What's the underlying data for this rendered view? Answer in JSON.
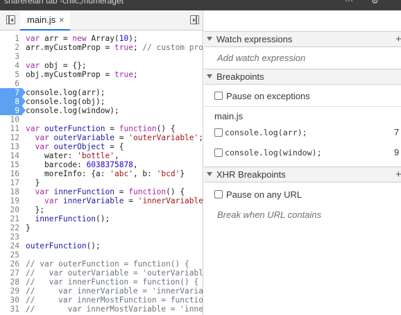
{
  "titlebar": {
    "text": "sharerelan tab -chilc,/numeraget"
  },
  "editor": {
    "tab_label": "main.js",
    "close_glyph": "×",
    "breakpoint_lines": [
      7,
      8,
      9
    ],
    "lines": [
      {
        "n": "1",
        "html": "<span class='kw'>var</span> arr = <span class='kw'>new</span> Array(<span class='num'>10</span>);"
      },
      {
        "n": "2",
        "html": "arr.myCustomProp = <span class='kw'>true</span>; <span class='cm'>// custom prop</span>"
      },
      {
        "n": "3",
        "html": ""
      },
      {
        "n": "4",
        "html": "<span class='kw'>var</span> obj = {};"
      },
      {
        "n": "5",
        "html": "obj.myCustomProp = <span class='kw'>true</span>;"
      },
      {
        "n": "6",
        "html": ""
      },
      {
        "n": "7",
        "html": "console.log(arr);"
      },
      {
        "n": "8",
        "html": "console.log(obj);"
      },
      {
        "n": "9",
        "html": "console.log(window);"
      },
      {
        "n": "10",
        "html": ""
      },
      {
        "n": "11",
        "html": "<span class='kw'>var</span> <span class='vr'>outerFunction</span> = <span class='kw'>function</span>() {"
      },
      {
        "n": "12",
        "html": "  <span class='kw'>var</span> <span class='vr'>outerVariable</span> = <span class='str'>'outerVariable'</span>;"
      },
      {
        "n": "13",
        "html": "  <span class='kw'>var</span> <span class='vr'>outerObject</span> = {"
      },
      {
        "n": "14",
        "html": "    water: <span class='str'>'bottle'</span>,"
      },
      {
        "n": "15",
        "html": "    barcode: <span class='num'>6038375878</span>,"
      },
      {
        "n": "16",
        "html": "    moreInfo: {a: <span class='str'>'abc'</span>, b: <span class='str'>'bcd'</span>}"
      },
      {
        "n": "17",
        "html": "  }"
      },
      {
        "n": "18",
        "html": "  <span class='kw'>var</span> <span class='vr'>innerFunction</span> = <span class='kw'>function</span>() {"
      },
      {
        "n": "19",
        "html": "    <span class='kw'>var</span> <span class='vr'>innerVariable</span> = <span class='str'>'innerVariable'</span>"
      },
      {
        "n": "20",
        "html": "  };"
      },
      {
        "n": "21",
        "html": "  <span class='vr'>innerFunction</span>();"
      },
      {
        "n": "22",
        "html": "}"
      },
      {
        "n": "23",
        "html": ""
      },
      {
        "n": "24",
        "html": "<span class='vr'>outerFunction</span>();"
      },
      {
        "n": "25",
        "html": ""
      },
      {
        "n": "26",
        "html": "<span class='cm'>// var outerFunction = function() {</span>"
      },
      {
        "n": "27",
        "html": "<span class='cm'>//   var outerVariable = 'outerVariable</span>"
      },
      {
        "n": "28",
        "html": "<span class='cm'>//   var innerFunction = function() {</span>"
      },
      {
        "n": "29",
        "html": "<span class='cm'>//     var innerVariable = 'innerVariab</span>"
      },
      {
        "n": "30",
        "html": "<span class='cm'>//     var innerMostFunction = function</span>"
      },
      {
        "n": "31",
        "html": "<span class='cm'>//       var innerMostVariable = 'inner</span>"
      }
    ]
  },
  "sidebar": {
    "watch": {
      "title": "Watch expressions",
      "hint": "Add watch expression"
    },
    "breakpoints": {
      "title": "Breakpoints",
      "pause_on_exceptions": "Pause on exceptions",
      "file": "main.js",
      "items": [
        {
          "code": "console.log(arr);",
          "line": "7"
        },
        {
          "code": "console.log(window);",
          "line": "9"
        }
      ]
    },
    "xhr": {
      "title": "XHR Breakpoints",
      "pause_any": "Pause on any URL",
      "hint": "Break when URL contains"
    }
  },
  "colors": {
    "breakpoint": "#5ea1f3",
    "tab_underline": "#1a73e8",
    "panel_header": "#f3f3f3"
  }
}
